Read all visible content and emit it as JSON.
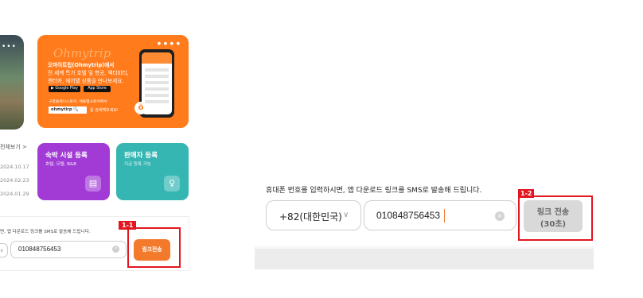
{
  "left_panel": {
    "photo_dots": "•••",
    "promo": {
      "brand": "Ohmytrip",
      "line1": "오마이트립(Ohmytrip)에서",
      "line2": "전 세계 특가 호텔 및 항공, 액티비티,",
      "line3": "렌터카, 에어텔 상품을 만나보세요.",
      "google_play": "▶ Google Play",
      "app_store": " App Store",
      "hint": "구글플레이스토어, 애플앱스토어에서",
      "search_text": "ohmytirp 🔍",
      "search_tail": "를 검색해보세요!",
      "pager": "● ● ● ●",
      "badge": "ö"
    },
    "more_link": "전체보기 >",
    "dates": [
      "2024.10.17",
      "2024.02.23",
      "2024.01.29"
    ],
    "cards": [
      {
        "title": "숙박 시설 등록",
        "sub": "호텔, 모텔, B&B",
        "icon": "▤"
      },
      {
        "title": "판매자 등록",
        "sub": "지금 등록 가능",
        "icon": "♀"
      }
    ],
    "sms": {
      "text": "면, 앱 다운로드 링크를 SMS로 발송해 드립니다.",
      "chevron": "∨",
      "phone": "010848756453",
      "clear": "×",
      "button": "링크전송"
    },
    "marker": "1-1"
  },
  "right_panel": {
    "sms_text": "휴대폰 번호를 입력하시면, 앱 다운로드 링크를 SMS로 발송해 드립니다.",
    "country": "+82(대한민국)",
    "chevron": "∨",
    "phone": "010848756453",
    "clear": "×",
    "button_line1": "링크 전송",
    "button_line2": "(30초)",
    "marker": "1-2"
  },
  "colors": {
    "orange": "#ff7b1c",
    "purple": "#a23bd6",
    "teal": "#36b6b3",
    "marker_red": "#e3161f"
  }
}
